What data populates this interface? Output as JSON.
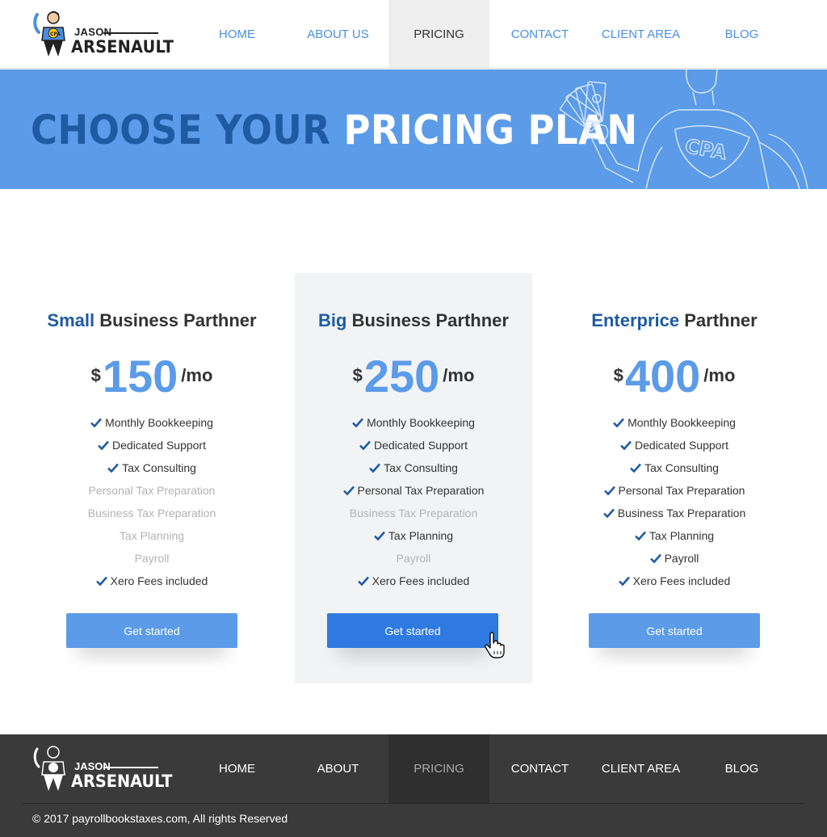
{
  "brand": {
    "line1": "JASON",
    "line2": "ARSENAULT",
    "badge": "CPA"
  },
  "nav": [
    {
      "label": "HOME",
      "active": false
    },
    {
      "label": "ABOUT US",
      "active": false
    },
    {
      "label": "PRICING",
      "active": true
    },
    {
      "label": "CONTACT",
      "active": false
    },
    {
      "label": "CLIENT AREA",
      "active": false
    },
    {
      "label": "BLOG",
      "active": false
    }
  ],
  "hero": {
    "title_dark": "CHOOSE YOUR",
    "title_light": "PRICING PLAN",
    "art_badge": "CPA"
  },
  "plans": [
    {
      "accent": "Small",
      "title_rest": " Business Parthner",
      "currency": "$",
      "amount": "150",
      "period": "/mo",
      "features": [
        {
          "label": "Monthly Bookkeeping",
          "included": true
        },
        {
          "label": "Dedicated Support",
          "included": true
        },
        {
          "label": "Tax Consulting",
          "included": true
        },
        {
          "label": "Personal Tax Preparation",
          "included": false
        },
        {
          "label": "Business Tax Preparation",
          "included": false
        },
        {
          "label": "Tax Planning",
          "included": false
        },
        {
          "label": "Payroll",
          "included": false
        },
        {
          "label": "Xero Fees included",
          "included": true
        }
      ],
      "cta": "Get started",
      "featured": false
    },
    {
      "accent": "Big",
      "title_rest": " Business Parthner",
      "currency": "$",
      "amount": "250",
      "period": "/mo",
      "features": [
        {
          "label": "Monthly Bookkeeping",
          "included": true
        },
        {
          "label": "Dedicated Support",
          "included": true
        },
        {
          "label": "Tax Consulting",
          "included": true
        },
        {
          "label": "Personal Tax Preparation",
          "included": true
        },
        {
          "label": "Business Tax Preparation",
          "included": false
        },
        {
          "label": "Tax Planning",
          "included": true
        },
        {
          "label": "Payroll",
          "included": false
        },
        {
          "label": "Xero Fees included",
          "included": true
        }
      ],
      "cta": "Get started",
      "featured": true
    },
    {
      "accent": "Enterprice",
      "title_rest": " Parthner",
      "currency": "$",
      "amount": "400",
      "period": "/mo",
      "features": [
        {
          "label": "Monthly Bookkeeping",
          "included": true
        },
        {
          "label": "Dedicated Support",
          "included": true
        },
        {
          "label": "Tax Consulting",
          "included": true
        },
        {
          "label": "Personal Tax Preparation",
          "included": true
        },
        {
          "label": "Business Tax Preparation",
          "included": true
        },
        {
          "label": "Tax Planning",
          "included": true
        },
        {
          "label": "Payroll",
          "included": true
        },
        {
          "label": "Xero Fees included",
          "included": true
        }
      ],
      "cta": "Get started",
      "featured": false
    }
  ],
  "footer": {
    "nav": [
      {
        "label": "HOME",
        "active": false
      },
      {
        "label": "ABOUT",
        "active": false
      },
      {
        "label": "PRICING",
        "active": true
      },
      {
        "label": "CONTACT",
        "active": false
      },
      {
        "label": "CLIENT AREA",
        "active": false
      },
      {
        "label": "BLOG",
        "active": false
      }
    ],
    "copyright": "© 2017 payrollbookstaxes.com, All rights Reserved"
  },
  "icons": {
    "check": "check-icon",
    "cursor": "hand-pointer-icon",
    "mascot": "cpa-hero-icon"
  },
  "colors": {
    "accent": "#5b9be8",
    "accent_dark": "#1f5ba3",
    "button_active": "#2e7ae0",
    "footer_bg": "#3a3a3a",
    "muted": "#b3b3b3"
  }
}
